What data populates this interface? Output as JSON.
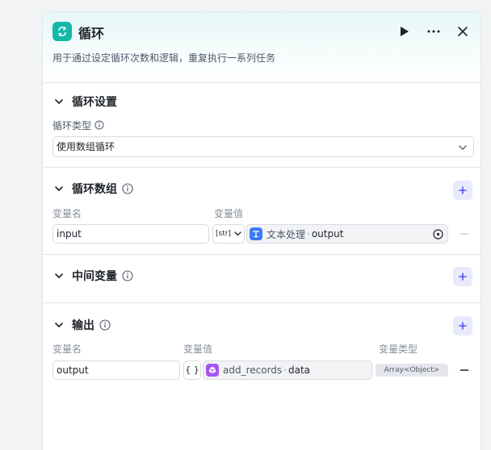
{
  "header": {
    "title": "循环",
    "description": "用于通过设定循环次数和逻辑，重复执行一系列任务"
  },
  "loop_settings": {
    "title": "循环设置",
    "type_label": "循环类型",
    "type_value": "使用数组循环"
  },
  "loop_array": {
    "title": "循环数组",
    "col_name": "变量名",
    "col_value": "变量值",
    "rows": [
      {
        "name": "input",
        "type_tag": "[str]",
        "source": "文本处理",
        "variable": "output"
      }
    ]
  },
  "intermediate": {
    "title": "中间变量"
  },
  "output": {
    "title": "输出",
    "col_name": "变量名",
    "col_value": "变量值",
    "col_type": "变量类型",
    "rows": [
      {
        "name": "output",
        "brace": "{ }",
        "source": "add_records",
        "variable": "data",
        "var_type": "Array<Object>"
      }
    ]
  },
  "colors": {
    "accent": "#14b8a6",
    "add_button_bg": "#e8eafc",
    "add_button_fg": "#4d53e8",
    "text_node_icon": "#3d7bf5",
    "plugin_node_icon": "#a855f7"
  }
}
